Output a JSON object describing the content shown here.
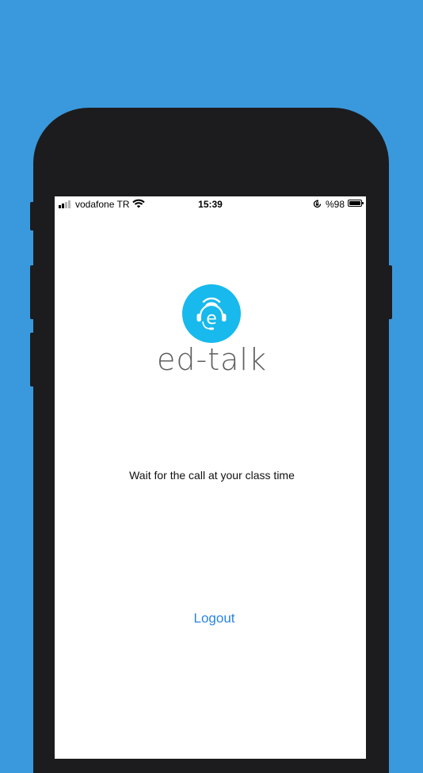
{
  "status_bar": {
    "carrier": "vodafone TR",
    "time": "15:39",
    "battery": "%98"
  },
  "brand": {
    "name": "ed-talk",
    "logo_color": "#18b9ec"
  },
  "main": {
    "message": "Wait for the call at your class time",
    "logout_label": "Logout"
  },
  "colors": {
    "background": "#3a99dc",
    "link": "#2a85e0"
  }
}
